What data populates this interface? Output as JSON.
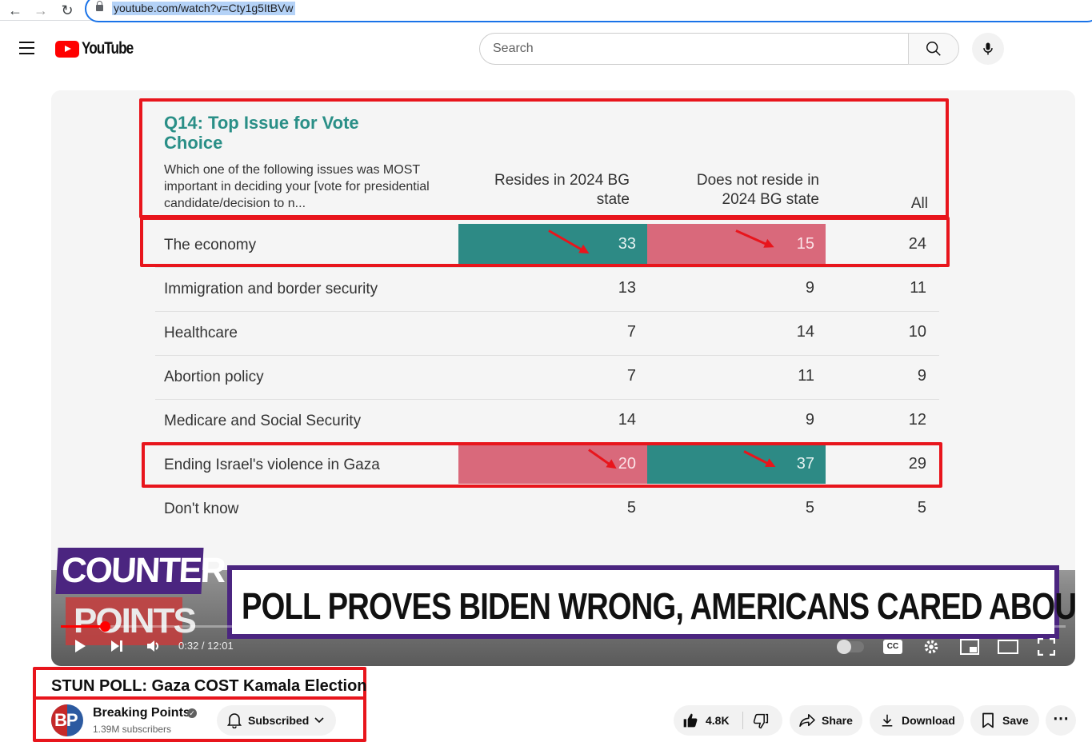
{
  "browser": {
    "url": "youtube.com/watch?v=Cty1g5ItBVw"
  },
  "header": {
    "logo_text": "YouTube",
    "search_placeholder": "Search"
  },
  "video": {
    "slide": {
      "question_title": "Q14: Top Issue for Vote Choice",
      "question_desc": "Which one of the following issues was MOST important in deciding your [vote for presidential candidate/decision to n...",
      "col1_header": "Resides in 2024 BG state",
      "col2_header": "Does not reside in 2024 BG state",
      "col3_header": "All",
      "rows": [
        {
          "label": "The economy",
          "c1": "33",
          "c2": "15",
          "c3": "24"
        },
        {
          "label": "Immigration and border security",
          "c1": "13",
          "c2": "9",
          "c3": "11"
        },
        {
          "label": "Healthcare",
          "c1": "7",
          "c2": "14",
          "c3": "10"
        },
        {
          "label": "Abortion policy",
          "c1": "7",
          "c2": "11",
          "c3": "9"
        },
        {
          "label": "Medicare and Social Security",
          "c1": "14",
          "c2": "9",
          "c3": "12"
        },
        {
          "label": "Ending Israel's violence in Gaza",
          "c1": "20",
          "c2": "37",
          "c3": "29"
        },
        {
          "label": "Don't know",
          "c1": "5",
          "c2": "5",
          "c3": "5"
        }
      ],
      "show_logo_top": "COUNTER",
      "show_logo_bottom": "POINTS",
      "banner": "POLL PROVES BIDEN WRONG, AMERICANS CARED ABOUT GAZA"
    },
    "time": "0:32 / 12:01",
    "progress_fraction": 0.044,
    "title": "STUN POLL: Gaza COST Kamala Election"
  },
  "channel": {
    "avatar_text": "BP",
    "name": "Breaking Points",
    "subscribers": "1.39M subscribers",
    "subscribe_label": "Subscribed"
  },
  "actions": {
    "likes": "4.8K",
    "share": "Share",
    "download": "Download",
    "save": "Save"
  },
  "colors": {
    "teal": "#2d8a85",
    "pink": "#d9697b",
    "highlight_red": "#e8151c",
    "youtube_red": "#ff0000"
  }
}
